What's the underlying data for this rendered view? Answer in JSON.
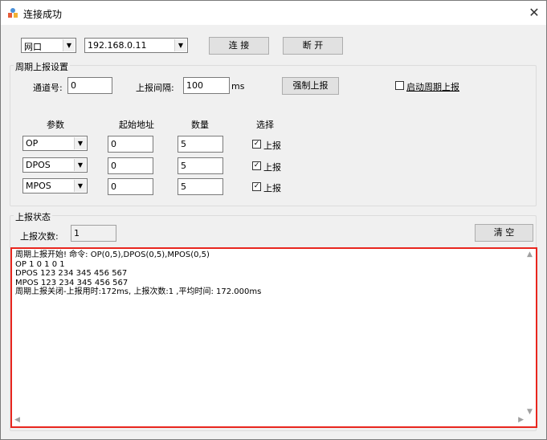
{
  "window": {
    "title": "连接成功",
    "close_glyph": "✕"
  },
  "connection": {
    "type_value": "网口",
    "ip_value": "192.168.0.11",
    "connect_label": "连  接",
    "disconnect_label": "断  开"
  },
  "period_group": {
    "title": "周期上报设置",
    "channel_label": "通道号:",
    "channel_value": "0",
    "interval_label": "上报间隔:",
    "interval_value": "100",
    "interval_unit": "ms",
    "force_label": "强制上报",
    "auto_label": "启动周期上报",
    "auto_checked": false,
    "col_param": "参数",
    "col_addr": "起始地址",
    "col_count": "数量",
    "col_select": "选择",
    "rows": [
      {
        "param": "OP",
        "addr": "0",
        "count": "5",
        "select_label": "上报",
        "checked": true
      },
      {
        "param": "DPOS",
        "addr": "0",
        "count": "5",
        "select_label": "上报",
        "checked": true
      },
      {
        "param": "MPOS",
        "addr": "0",
        "count": "5",
        "select_label": "上报",
        "checked": true
      }
    ]
  },
  "status_group": {
    "title": "上报状态",
    "count_label": "上报次数:",
    "count_value": "1",
    "clear_label": "清  空"
  },
  "log": {
    "lines": [
      "周期上报开始!  命令: OP(0,5),DPOS(0,5),MPOS(0,5)",
      "OP 1 0 1 0 1",
      "DPOS 123 234 345 456 567",
      "MPOS 123 234 345 456 567",
      "周期上报关闭-上报用时:172ms, 上报次数:1 ,平均时间: 172.000ms"
    ]
  },
  "colors": {
    "highlight_border": "#e8261e",
    "dialog_bg": "#f0f0f0"
  }
}
